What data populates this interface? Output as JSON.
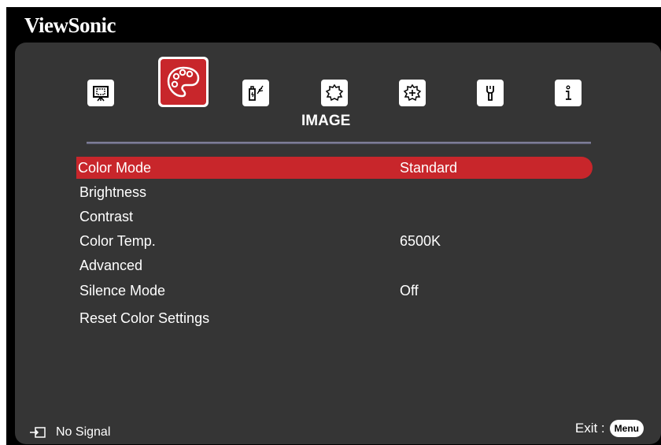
{
  "brand": "ViewSonic",
  "tabs": {
    "active_title": "IMAGE",
    "icons": [
      {
        "name": "display-icon"
      },
      {
        "name": "palette-icon"
      },
      {
        "name": "power-management-icon"
      },
      {
        "name": "basic-settings-icon"
      },
      {
        "name": "advanced-settings-icon"
      },
      {
        "name": "wrench-icon"
      },
      {
        "name": "info-icon"
      }
    ]
  },
  "menu": {
    "items": [
      {
        "label": "Color Mode",
        "value": "Standard"
      },
      {
        "label": "Brightness",
        "value": ""
      },
      {
        "label": "Contrast",
        "value": ""
      },
      {
        "label": "Color Temp.",
        "value": "6500K"
      },
      {
        "label": "Advanced",
        "value": ""
      },
      {
        "label": "Silence Mode",
        "value": "Off"
      },
      {
        "label": "Reset Color Settings",
        "value": ""
      }
    ]
  },
  "footer": {
    "signal": "No Signal",
    "exit_label": "Exit :",
    "menu_key": "Menu"
  },
  "colors": {
    "accent": "#c8262b",
    "panel": "#353535",
    "background": "#000000"
  }
}
